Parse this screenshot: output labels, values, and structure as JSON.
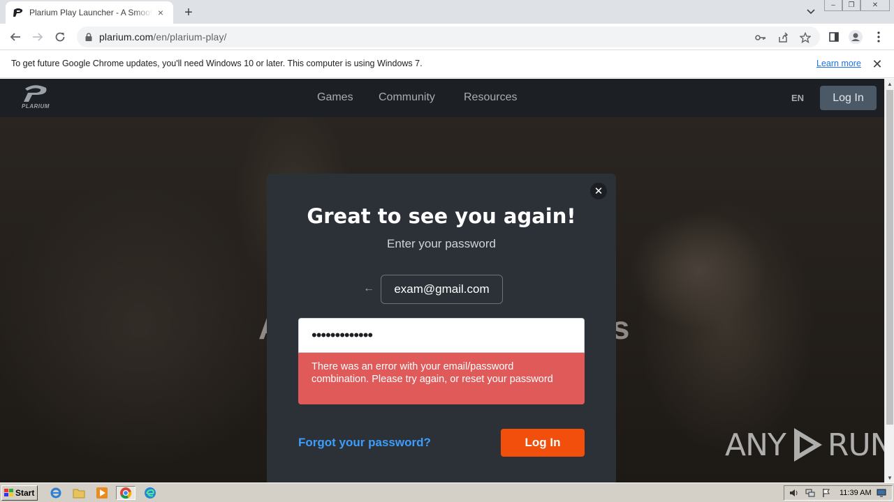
{
  "browser": {
    "tab_title": "Plarium Play Launcher - A Smoother Gaming Experience",
    "tab_close_glyph": "×",
    "new_tab_glyph": "+",
    "url_host": "plarium.com",
    "url_path": "/en/plarium-play/",
    "window_buttons": [
      "–",
      "❐",
      "✕"
    ]
  },
  "infobar": {
    "message": "To get future Google Chrome updates, you'll need Windows 10 or later. This computer is using Windows 7.",
    "learn_more": "Learn more",
    "close_glyph": "✕"
  },
  "site": {
    "logo_text": "PLARIUM",
    "nav": [
      "Games",
      "Community",
      "Resources"
    ],
    "lang": "EN",
    "login_label": "Log In",
    "hero_title_left": "A",
    "hero_title_right": "rs"
  },
  "modal": {
    "close_glyph": "✕",
    "title": "Great to see you again!",
    "subtitle": "Enter your password",
    "back_glyph": "←",
    "email": "exam@gmail.com",
    "password_mask": "•••••••••••••",
    "error": "There was an error with your email/password combination. Please try again, or reset your password",
    "forgot_label": "Forgot your password?",
    "login_label": "Log In"
  },
  "watermark": {
    "left": "ANY",
    "right": "RUN"
  },
  "taskbar": {
    "start_label": "Start",
    "clock": "11:39 AM"
  },
  "colors": {
    "accent_orange": "#f34f0c",
    "error_red": "#e05a5a",
    "link_blue": "#3d9dfb",
    "modal_bg": "#2c3138"
  },
  "icons": [
    "plarium-favicon-icon",
    "reload-icon",
    "lock-icon",
    "key-icon",
    "share-icon",
    "star-icon",
    "sidepanel-icon",
    "profile-icon",
    "kebab-menu-icon",
    "ie-icon",
    "folder-icon",
    "media-player-icon",
    "chrome-icon",
    "edge-icon",
    "speaker-icon",
    "network-icon",
    "flag-icon",
    "monitor-icon"
  ]
}
